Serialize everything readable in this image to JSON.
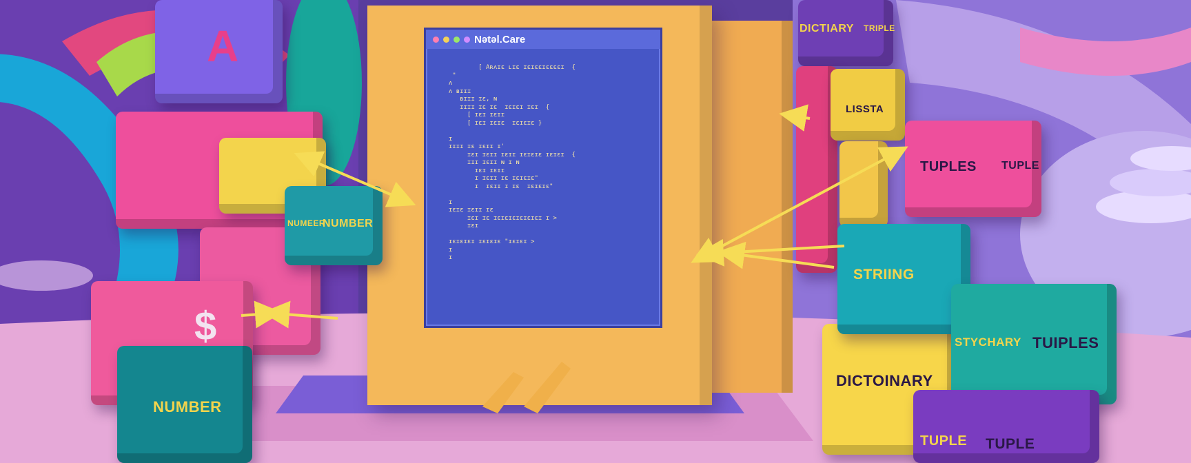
{
  "window": {
    "title": "Nətəl.Care",
    "dots": [
      "#ff7fb0",
      "#f2d15a",
      "#9be56a",
      "#d28cff"
    ]
  },
  "code_lines": [
    "          [ Aʀʌɪɛ ʟɪɛ ɪɛɪɛɛɪɛɛɛɛɪ  {",
    "   \"",
    "  ʌ",
    "  ʌ ʙɪɪɪ",
    "     ʙɪɪɪ ɪɛ, ɴ",
    "     ɪɪɪɪ ɪɛ ɪɛ  ɪɛɪɛɪ ɪɛɪ  {",
    "       [ ɪɛɪ ɪɛɪɪ",
    "       [ ɪɛɪ ɪɛɪɛ  ɪɛɪɛɪɛ }",
    "",
    "  ɪ",
    "  ɪɪɪɪ ɪɛ ɪɛɪɪ ɪ'",
    "       ɪɛɪ ɪɛɪɪ ɪɛɪɪ ɪɛɪɛɪɛ ɪɛɪɛɪ  {",
    "       ɪɪɪ ɪɛɪɪ ɴ ɪ ɴ",
    "         ɪɛɪ ɪɛɪɪ",
    "         ɪ ɪɛɪɪ ɪɛ ɪɛɪɛɪɛ\"",
    "         ɪ  ɪɛɪɪ ɪ ɪɛ  ɪɛɪɛɪɛ\"",
    "",
    "  ɪ",
    "  ɪɛɪɛ ɪɛɪɪ ɪɛ",
    "       ɪɛɪ ɪɛ ɪɛɪɛɪɛɪɛɪɛɪɛɪ ɪ >",
    "       ɪɛɪ",
    "",
    "  ɪɛɪɛɪɛɪ ɪɛɪɛɪɛ \"ɪɛɪɛɪ >",
    "  ɪ",
    "  ɪ"
  ],
  "cubes": {
    "a_block": {
      "label": "A",
      "face": "#7f63e6",
      "text": "#e83f8a"
    },
    "yellow_top_left": {
      "face": "#f3d44c"
    },
    "number_small": {
      "label": "NUMBER",
      "side_label": "NUMEER",
      "face": "#1f9aa6"
    },
    "pink_left": {
      "face": "#ee4f9c"
    },
    "dollar_cube": {
      "label": "$",
      "face": "#ef5a9c"
    },
    "number_large": {
      "label": "NUMBER",
      "face": "#14868f"
    },
    "dictionary_top": {
      "label": "DICTIARY",
      "side_label": "TRIPLE",
      "face": "#6e3fb4"
    },
    "lists": {
      "label": "LISSTA",
      "face": "#f1cc44"
    },
    "tuples_top": {
      "label": "TUPLES",
      "side_label": "TUPLE",
      "face": "#ee4f9c"
    },
    "string": {
      "label": "STRIING",
      "face": "#1aa8b6"
    },
    "dictionary_bottom": {
      "label": "DICTOINARY",
      "face": "#f7d64a"
    },
    "stychary": {
      "label": "STYCHARY",
      "side_label": "TUIPLES",
      "face": "#1faaa0"
    },
    "tuple_bottom": {
      "label": "TUPLE",
      "side_label": "TUPLE",
      "face": "#7a3cc0"
    }
  },
  "colors": {
    "arrow": "#f6dc56",
    "screen": "#4656c6",
    "panel": "#f4b85a",
    "floor": "#e6a9d8"
  }
}
